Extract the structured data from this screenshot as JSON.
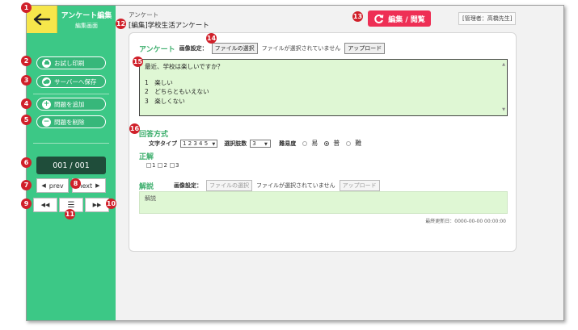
{
  "sidebar": {
    "title": "アンケート編集",
    "subtitle": "編集画面",
    "buttons": {
      "print": "お試し印刷",
      "save": "サーバーへ保存",
      "add": "問題を追加",
      "delete": "問題を削除"
    },
    "page_counter": "001 / 001",
    "prev": "prev",
    "next": "next"
  },
  "header": {
    "breadcrumb": "アンケート",
    "title": "[編集]学校生活アンケート",
    "edit_view_button": "編集 / 閲覧",
    "admin": "[管理者：高橋先生]"
  },
  "question": {
    "heading": "アンケート",
    "image_label": "画像設定：",
    "file_button": "ファイルの選択",
    "file_note": "ファイルが選択されていません",
    "upload_button": "アップロード",
    "text_line": "最近、学校は楽しいですか？",
    "option_1": "1　楽しい",
    "option_2": "2　どちらともいえない",
    "option_3": "3　楽しくない"
  },
  "answer": {
    "heading": "回答方式",
    "text_type_label": "文字タイプ",
    "text_type_value": "1 2 3 4 5",
    "choice_count_label": "選択肢数",
    "choice_count_value": "3",
    "difficulty_label": "難易度",
    "difficulty_easy": "易",
    "difficulty_normal": "普",
    "difficulty_hard": "難",
    "difficulty_selected": "普",
    "correct_heading": "正解",
    "correct_1": "1",
    "correct_2": "2",
    "correct_3": "3"
  },
  "explanation": {
    "heading": "解説",
    "image_label": "画像設定：",
    "file_button": "ファイルの選択",
    "file_note": "ファイルが選択されていません",
    "upload_button": "アップロード",
    "placeholder": "解説",
    "last_updated": "最終更新日：0000-00-00 00:00:00"
  },
  "badges": [
    "1",
    "2",
    "3",
    "4",
    "5",
    "6",
    "7",
    "8",
    "9",
    "10",
    "11",
    "12",
    "13",
    "14",
    "15",
    "16"
  ],
  "colors": {
    "sidebar_green": "#3cc886",
    "back_yellow": "#f6e64b",
    "edit_pink": "#ee2f55",
    "badge_red": "#d0202a",
    "answer_box_green": "#dff7d4"
  }
}
